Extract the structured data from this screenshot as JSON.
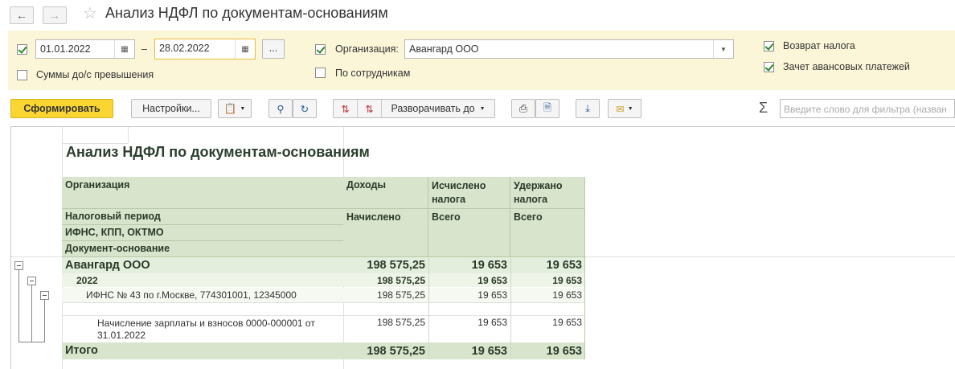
{
  "window": {
    "title": "Анализ НДФЛ по документам-основаниям",
    "back_icon": "arrow-left-icon",
    "forward_icon": "arrow-right-icon"
  },
  "filters": {
    "period_enabled": true,
    "date_from": "01.01.2022",
    "date_to": "28.02.2022",
    "dash": "–",
    "more_label": "...",
    "excess_label": "Суммы до/с превышения",
    "excess_checked": false,
    "org_enabled": true,
    "org_label": "Организация:",
    "org_value": "Авангард ООО",
    "by_employee_label": "По сотрудникам",
    "by_employee_checked": false,
    "refund_label": "Возврат налога",
    "refund_checked": true,
    "advance_label": "Зачет авансовых платежей",
    "advance_checked": true
  },
  "toolbar": {
    "generate_label": "Сформировать",
    "settings_label": "Настройки...",
    "expand_label": "Разворачивать до",
    "filter_placeholder": "Введите слово для фильтра (назван",
    "sigma": "Σ"
  },
  "report": {
    "title": "Анализ НДФЛ по документам-основаниям",
    "headers": {
      "org": "Организация",
      "period": "Налоговый период",
      "ifns": "ИФНС, КПП, ОКТМО",
      "doc": "Документ-основание",
      "income": "Доходы",
      "income_sub": "Начислено",
      "calc": "Исчислено налога",
      "calc_sub": "Всего",
      "withheld": "Удержано налога",
      "withheld_sub": "Всего"
    },
    "rows": {
      "org": {
        "name": "Авангард ООО",
        "income": "198 575,25",
        "calc": "19 653",
        "withheld": "19 653"
      },
      "year": {
        "name": "2022",
        "income": "198 575,25",
        "calc": "19 653",
        "withheld": "19 653"
      },
      "ifns": {
        "name": "ИФНС № 43 по г.Москве, 774301001, 12345000",
        "income": "198 575,25",
        "calc": "19 653",
        "withheld": "19 653"
      },
      "doc": {
        "name": "Начисление зарплаты и взносов 0000-000001 от 31.01.2022",
        "income": "198 575,25",
        "calc": "19 653",
        "withheld": "19 653"
      }
    },
    "total": {
      "label": "Итого",
      "income": "198 575,25",
      "calc": "19 653",
      "withheld": "19 653"
    }
  }
}
